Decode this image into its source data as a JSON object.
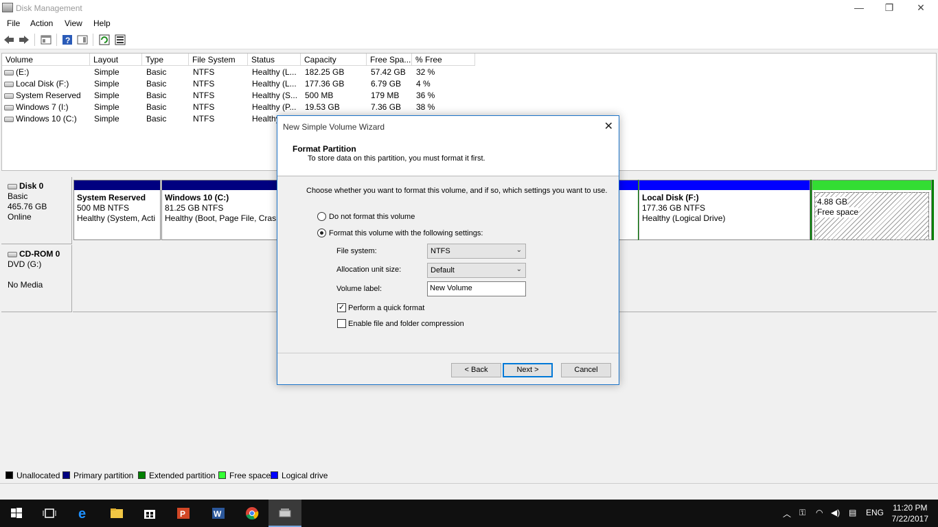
{
  "window": {
    "title": "Disk Management",
    "minimize": "—",
    "restore": "❐",
    "close": "✕"
  },
  "menu": [
    "File",
    "Action",
    "View",
    "Help"
  ],
  "volume_table": {
    "columns": [
      "Volume",
      "Layout",
      "Type",
      "File System",
      "Status",
      "Capacity",
      "Free Spa...",
      "% Free"
    ],
    "rows": [
      [
        "(E:)",
        "Simple",
        "Basic",
        "NTFS",
        "Healthy (L...",
        "182.25 GB",
        "57.42 GB",
        "32 %"
      ],
      [
        "Local Disk (F:)",
        "Simple",
        "Basic",
        "NTFS",
        "Healthy (L...",
        "177.36 GB",
        "6.79 GB",
        "4 %"
      ],
      [
        "System Reserved",
        "Simple",
        "Basic",
        "NTFS",
        "Healthy (S...",
        "500 MB",
        "179 MB",
        "36 %"
      ],
      [
        "Windows 7 (I:)",
        "Simple",
        "Basic",
        "NTFS",
        "Healthy (P...",
        "19.53 GB",
        "7.36 GB",
        "38 %"
      ],
      [
        "Windows 10 (C:)",
        "Simple",
        "Basic",
        "NTFS",
        "Healthy",
        "",
        "",
        ""
      ]
    ]
  },
  "disks": {
    "disk0": {
      "name": "Disk 0",
      "type": "Basic",
      "size": "465.76 GB",
      "state": "Online",
      "partitions": {
        "system_reserved": {
          "name": "System Reserved",
          "size": "500 MB NTFS",
          "status": "Healthy (System, Acti"
        },
        "windows10": {
          "name": "Windows 10  (C:)",
          "size": "81.25 GB NTFS",
          "status": "Healthy (Boot, Page File, Crash"
        },
        "local_disk_f": {
          "name": "Local Disk  (F:)",
          "size": "177.36 GB NTFS",
          "status": "Healthy (Logical Drive)"
        },
        "free": {
          "size": "4.88 GB",
          "status": "Free space"
        }
      }
    },
    "cdrom0": {
      "name": "CD-ROM 0",
      "drive": "DVD (G:)",
      "media": "No Media"
    }
  },
  "legend": [
    {
      "label": "Unallocated",
      "color": "#000000"
    },
    {
      "label": "Primary partition",
      "color": "#000080"
    },
    {
      "label": "Extended partition",
      "color": "#008000"
    },
    {
      "label": "Free space",
      "color": "#33ff33"
    },
    {
      "label": "Logical drive",
      "color": "#0000ff"
    }
  ],
  "colors": {
    "primary_bar": "#000080",
    "logical_bar": "#0000ff",
    "extended_border": "#008000",
    "free_bar": "#33dd33"
  },
  "dialog": {
    "title": "New Simple Volume Wizard",
    "heading": "Format Partition",
    "subheading": "To store data on this partition, you must format it first.",
    "instruction": "Choose whether you want to format this volume, and if so, which settings you want to use.",
    "option_no_format": "Do not format this volume",
    "option_format": "Format this volume with the following settings:",
    "file_system_label": "File system:",
    "file_system_value": "NTFS",
    "allocation_label": "Allocation unit size:",
    "allocation_value": "Default",
    "volume_label_label": "Volume label:",
    "volume_label_value": "New Volume",
    "quick_format_label": "Perform a quick format",
    "quick_format_checked": true,
    "compression_label": "Enable file and folder compression",
    "compression_checked": false,
    "back_button": "< Back",
    "next_button": "Next >",
    "cancel_button": "Cancel"
  },
  "taskbar": {
    "language": "ENG",
    "time": "11:20 PM",
    "date": "7/22/2017",
    "apps": [
      "windows-start",
      "task-view",
      "edge",
      "file-explorer",
      "store",
      "powerpoint",
      "word",
      "chrome",
      "disk-management"
    ]
  }
}
